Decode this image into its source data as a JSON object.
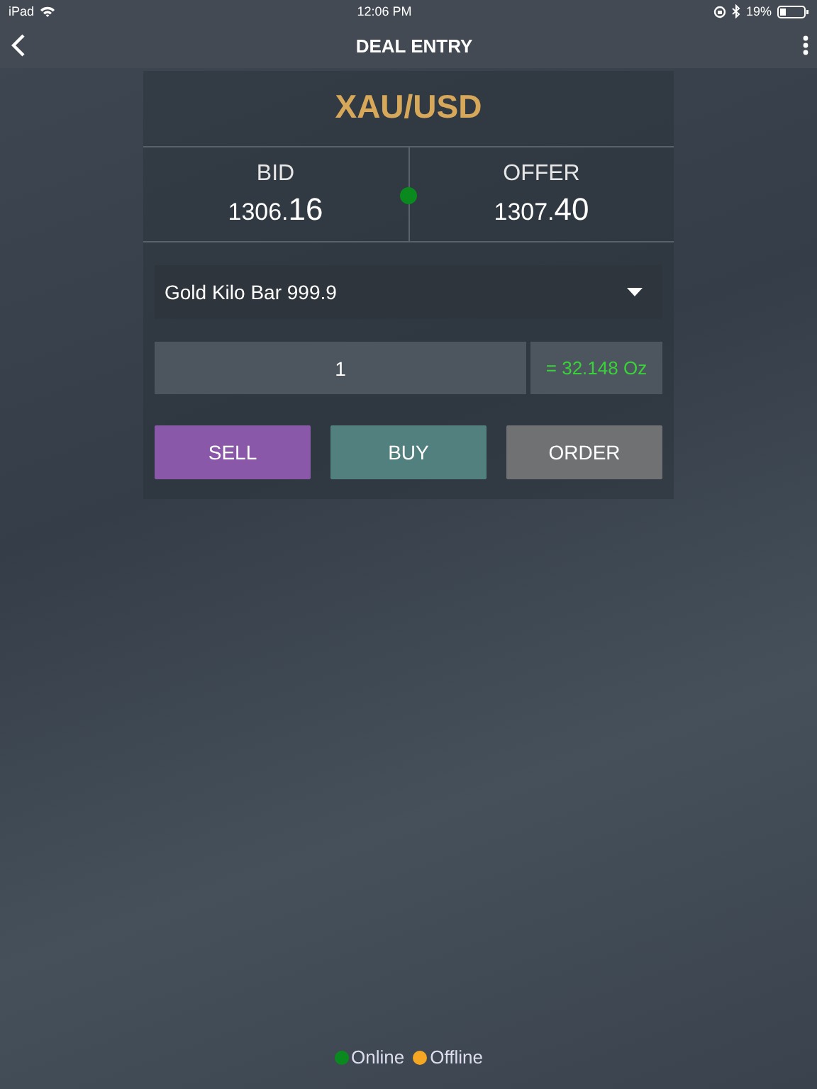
{
  "status_bar": {
    "device": "iPad",
    "time": "12:06 PM",
    "battery": "19%"
  },
  "nav": {
    "title": "DEAL ENTRY"
  },
  "symbol": "XAU/USD",
  "quotes": [
    {
      "label": "BID",
      "price_main": "1306.",
      "price_pips": "16"
    },
    {
      "label": "OFFER",
      "price_main": "1307.",
      "price_pips": "40"
    }
  ],
  "connection_dot": {
    "color": "#0a8a1e"
  },
  "product": {
    "value": "Gold Kilo Bar 999.9"
  },
  "quantity": {
    "value": "1",
    "conversion": "= 32.148 Oz"
  },
  "buttons": [
    {
      "label": "SELL",
      "kind": "sell"
    },
    {
      "label": "BUY",
      "kind": "buy"
    },
    {
      "label": "ORDER",
      "kind": "order"
    }
  ],
  "legend": [
    {
      "label": "Online",
      "color": "#0a8a1e"
    },
    {
      "label": "Offline",
      "color": "#f5a623"
    }
  ]
}
